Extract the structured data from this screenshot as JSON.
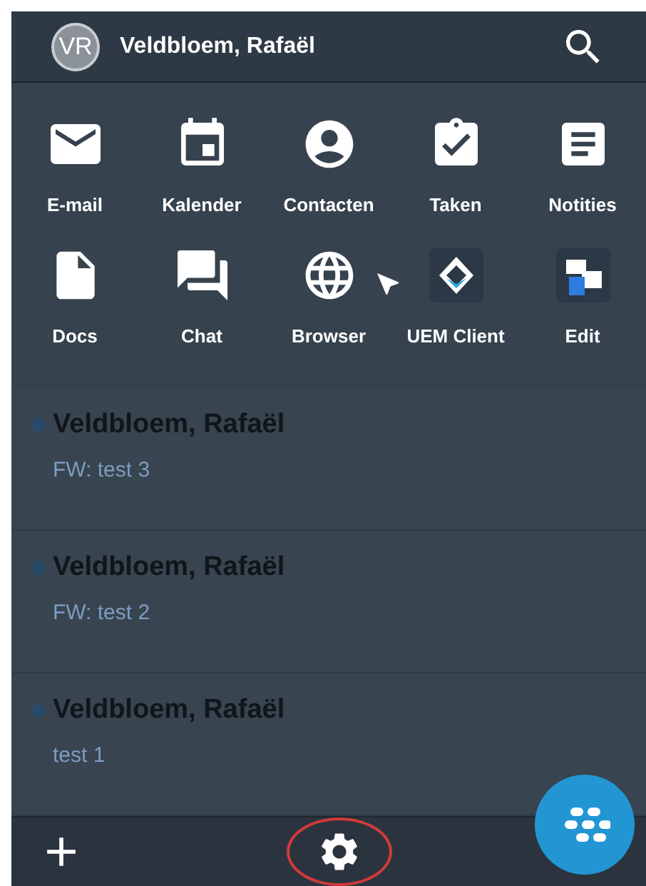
{
  "header": {
    "avatar": "VR",
    "name": "Veldbloem, Rafaël"
  },
  "apps": [
    {
      "label": "E-mail"
    },
    {
      "label": "Kalender"
    },
    {
      "label": "Contacten"
    },
    {
      "label": "Taken"
    },
    {
      "label": "Notities"
    },
    {
      "label": "Docs"
    },
    {
      "label": "Chat"
    },
    {
      "label": "Browser"
    },
    {
      "label": "UEM Client"
    },
    {
      "label": "Edit"
    }
  ],
  "messages": [
    {
      "sender": "Veldbloem, Rafaël",
      "subject": "FW: test 3",
      "unread": true
    },
    {
      "sender": "Veldbloem, Rafaël",
      "subject": "FW: test 2",
      "unread": true
    },
    {
      "sender": "Veldbloem, Rafaël",
      "subject": "test 1",
      "unread": true
    }
  ],
  "bottom_bar": {
    "settings_highlighted": true
  }
}
